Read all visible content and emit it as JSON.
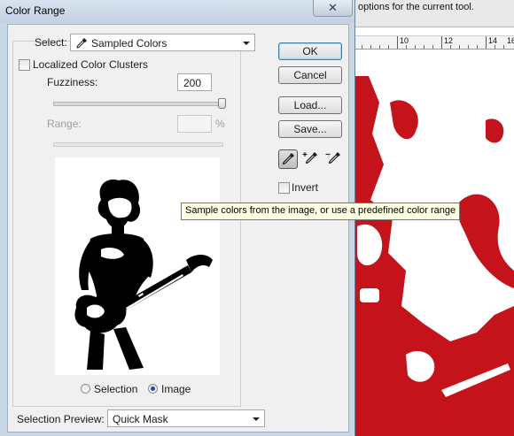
{
  "background": {
    "options_text": "options for the current tool.",
    "ruler_labels": [
      "10",
      "12",
      "14",
      "16"
    ],
    "art_color": "#c4131a"
  },
  "dialog": {
    "title": "Color Range",
    "close_glyph": "✕",
    "select_label": "Select:",
    "select_value": "Sampled Colors",
    "localized_label": "Localized Color Clusters",
    "localized_checked": false,
    "fuzziness_label": "Fuzziness:",
    "fuzziness_value": "200",
    "range_label": "Range:",
    "range_value": "",
    "range_unit": "%",
    "preview_options": {
      "selection_label": "Selection",
      "image_label": "Image",
      "selected": "Image"
    },
    "selection_preview_label": "Selection Preview:",
    "selection_preview_value": "Quick Mask",
    "buttons": {
      "ok": "OK",
      "cancel": "Cancel",
      "load": "Load...",
      "save": "Save..."
    },
    "invert_label": "Invert",
    "invert_checked": false,
    "tools": [
      "eyedropper-icon",
      "eyedropper-plus-icon",
      "eyedropper-minus-icon"
    ],
    "tooltip": "Sample colors from the image, or use a predefined color range"
  }
}
